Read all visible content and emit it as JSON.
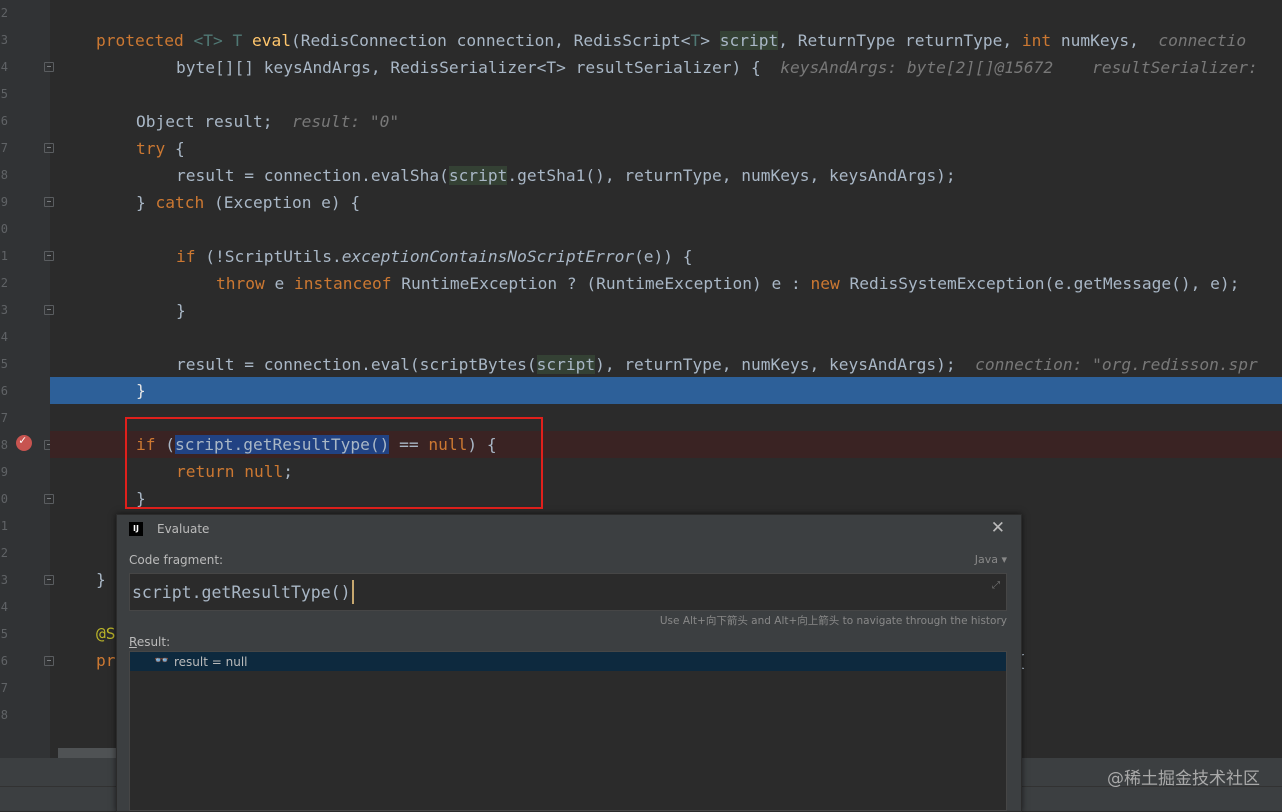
{
  "editor": {
    "line_numbers": [
      "2",
      "3",
      "4",
      "5",
      "6",
      "7",
      "8",
      "9",
      "0",
      "1",
      "2",
      "3",
      "4",
      "5",
      "6",
      "7",
      "8",
      "9",
      "0",
      "1",
      "2",
      "3",
      "4",
      "5",
      "6",
      "7",
      "8"
    ],
    "lines": {
      "l1": {
        "protected": "protected",
        "generic1": "<T>",
        "rettype": "T",
        "name": "eval",
        "p1": "(RedisConnection connection, RedisScript<",
        "generic2": "T",
        "p2": "> ",
        "script": "script",
        "p3": ", ReturnType returnType, ",
        "int": "int",
        "p4": " numKeys,  ",
        "hint": "connectio"
      },
      "l2": {
        "code": "byte[][] keysAndArgs, RedisSerializer<T> resultSerializer) {  ",
        "hint1": "keysAndArgs: byte[2][]@15672",
        "hint2": "resultSerializer:"
      },
      "l3": {
        "code": "Object result;  ",
        "hint": "result: \"0\""
      },
      "l4": {
        "try": "try",
        "brace": " {"
      },
      "l5": {
        "p1": "result = connection.evalSha(",
        "script": "script",
        "p2": ".getSha1(), returnType, numKeys, keysAndArgs);"
      },
      "l6": {
        "p1": "} ",
        "catch": "catch",
        "p2": " (Exception e) {"
      },
      "l7": {
        "if": "if",
        "p1": " (!ScriptUtils.",
        "method": "exceptionContainsNoScriptError",
        "p2": "(e)) {"
      },
      "l8": {
        "throw": "throw",
        "p1": " e ",
        "instanceof": "instanceof",
        "p2": " RuntimeException ? (RuntimeException) e : ",
        "new": "new",
        "p3": " RedisSystemException(e.getMessage(), e);"
      },
      "l9": {
        "code": "}"
      },
      "l10": {
        "p1": "result = connection.eval(scriptBytes(",
        "script": "script",
        "p2": "), returnType, numKeys, keysAndArgs);  ",
        "hint": "connection: \"org.redisson.spr"
      },
      "l11": {
        "code": "}"
      },
      "l12": {
        "if": "if",
        "p1": " (",
        "sel": "script.getResultType()",
        "p2": " == ",
        "null": "null",
        "p3": ") {"
      },
      "l13": {
        "return": "return",
        "p1": " ",
        "null": "null",
        "p2": ";"
      },
      "l14": {
        "code": "}"
      },
      "l15": {
        "code": "}"
      },
      "l16": {
        "code": "@S"
      },
      "l17": {
        "code": "pr",
        "brace": "{"
      }
    }
  },
  "dialog": {
    "logo": "IJ",
    "title": "Evaluate",
    "close": "✕",
    "code_fragment_label": "Code fragment:",
    "language": "Java ▾",
    "expression": "script.getResultType()",
    "expand": "⤢",
    "history_hint": "Use Alt+向下箭头 and Alt+向上箭头 to navigate through the history",
    "result_label_first": "R",
    "result_label_rest": "esult:",
    "result_icon": "👓",
    "result_text": "result = null"
  },
  "watermark": "@稀土掘金技术社区",
  "colors": {
    "background": "#2b2b2b",
    "keyword": "#cc7832",
    "method": "#ffc66d",
    "selection": "#214283",
    "current_line": "#2d6099",
    "red_box": "#e0201c"
  }
}
